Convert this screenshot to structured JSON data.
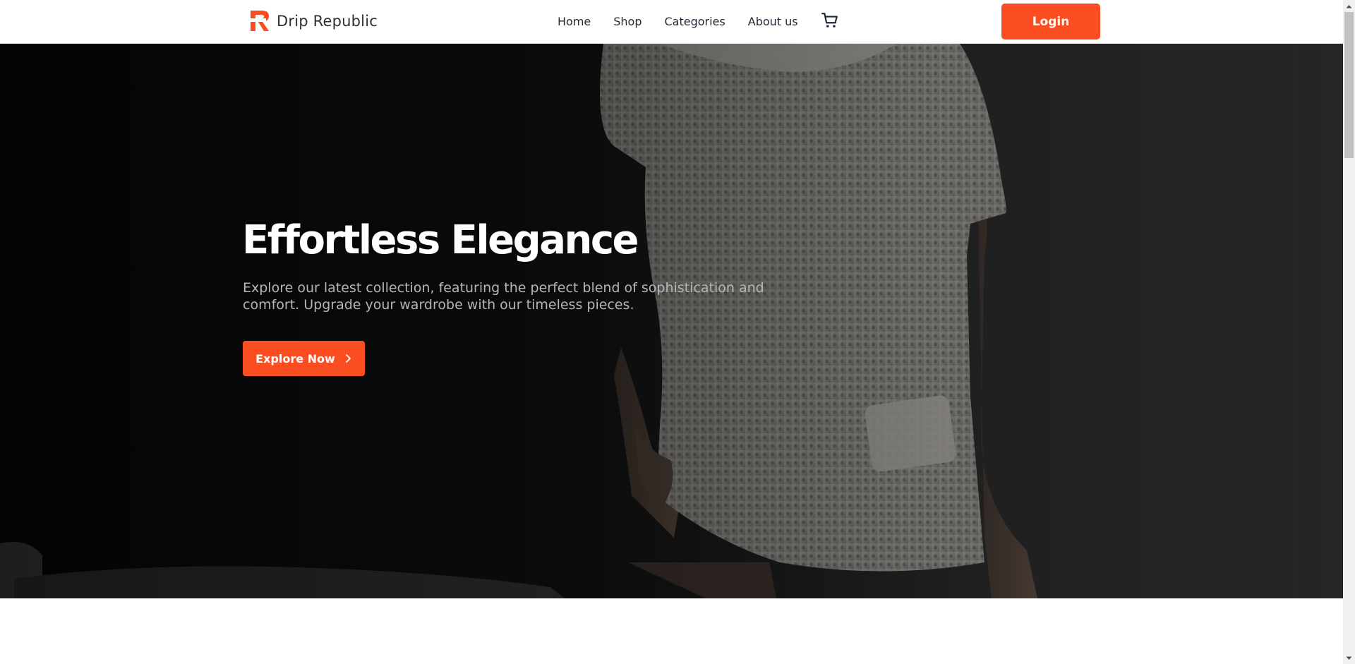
{
  "brand": {
    "name": "Drip Republic",
    "accent": "#fa4d22"
  },
  "nav": {
    "items": [
      {
        "label": "Home"
      },
      {
        "label": "Shop"
      },
      {
        "label": "Categories"
      },
      {
        "label": "About us"
      }
    ],
    "cart_icon": "shopping-cart-icon"
  },
  "header": {
    "login_label": "Login"
  },
  "hero": {
    "title": "Effortless Elegance",
    "subtitle": "Explore our latest collection, featuring the perfect blend of sophistication and comfort. Upgrade your wardrobe with our timeless pieces.",
    "cta_label": "Explore Now",
    "cta_icon": "chevron-right-icon",
    "image_subject": "model in white knit sweater dress"
  }
}
